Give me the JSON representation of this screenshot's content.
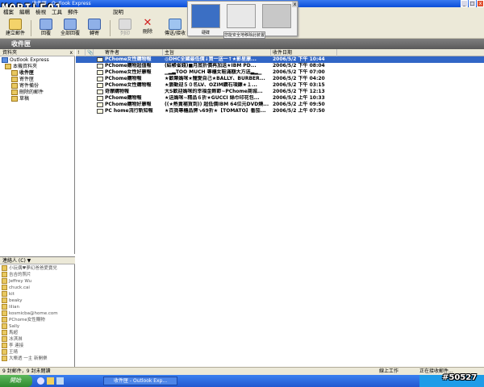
{
  "app": {
    "logo": "MOBILE01",
    "title": "收件匣 - Outlook Express"
  },
  "menubar": {
    "items": [
      "檔案",
      "編輯",
      "檢視",
      "工具",
      "郵件",
      "說明"
    ]
  },
  "toolbar": {
    "buttons": [
      {
        "label": "建立郵件",
        "icon": "new-mail-icon"
      },
      {
        "label": "回覆",
        "icon": "reply-icon"
      },
      {
        "label": "全部回覆",
        "icon": "reply-all-icon"
      },
      {
        "label": "轉寄",
        "icon": "forward-icon"
      },
      {
        "label": "列印",
        "icon": "print-icon"
      },
      {
        "label": "刪除",
        "icon": "delete-icon"
      },
      {
        "label": "傳送/接收",
        "icon": "send-receive-icon"
      }
    ]
  },
  "popup": {
    "device_label": "硬碟",
    "caption": "您能安全地移除此裝置"
  },
  "folder_header": {
    "title": "收件匣"
  },
  "folders": {
    "header": "資料夾",
    "items": [
      {
        "label": "Outlook Express",
        "indent": 0
      },
      {
        "label": "本機資料夾",
        "indent": 1
      },
      {
        "label": "收件匣",
        "indent": 2,
        "bold": true
      },
      {
        "label": "寄件匣",
        "indent": 2
      },
      {
        "label": "寄件備份",
        "indent": 2
      },
      {
        "label": "刪除的郵件",
        "indent": 2
      },
      {
        "label": "草稿",
        "indent": 2
      }
    ]
  },
  "contacts": {
    "header": "連絡人 (C) ▼",
    "items": [
      "小玩偶♥夢幻爸爸愛寶兒",
      "吉吉的照片",
      "Jeffrey Wu",
      "chuck.cai",
      "kit",
      "beaky",
      "lilian",
      "kosmicba@home.com",
      "PChome女性購物",
      "Sally",
      "馬超",
      "冰淇淋",
      "李 連接",
      "王晴",
      "大樂透 一主 新開樂"
    ]
  },
  "message_list": {
    "columns": [
      "!",
      "📎",
      "寄件者",
      "主旨",
      "收件日期"
    ],
    "rows": [
      {
        "from": "PChome女性購物報",
        "subject": "◎DHC全國最低價↓買一送一↑★影星康...",
        "date": "2006/5/2 下午 10:44",
        "selected": true
      },
      {
        "from": "PChome購物超值報",
        "subject": "(結帳省錢)■月底折價再加送★IBM PD...",
        "date": "2006/5/2 下午 08:04"
      },
      {
        "from": "PChome女性好康報",
        "subject": "▁▂▃TOO MUCH 專櫃女鞋滿額大方送▃▂▁",
        "date": "2006/5/2 下午 07:00"
      },
      {
        "from": "PChome購物報",
        "subject": "★歡樂媽咪★寵愛自己★BALLY、BURBER...",
        "date": "2006/5/2 下午 04:20"
      },
      {
        "from": "PChome女性購物報",
        "subject": "★脈動迎５０名LV、OZIM鑽石項鍊★１...",
        "date": "2006/5/2 下午 03:15"
      },
      {
        "from": "奇摩購物報",
        "subject": "大S歡迎媽咪的幸福金飾節~PChome商城...",
        "date": "2006/5/2 下午 12:13"
      },
      {
        "from": "PChome購物報",
        "subject": "★送媽咪~精品６折★GUCCI 絲巾印花包...",
        "date": "2006/5/2 上午 10:33"
      },
      {
        "from": "PChome購物好康報",
        "subject": "((★熱賣補貨到)) 超低價IBM 64位元DVD燒...",
        "date": "2006/5/2 上午 09:50"
      },
      {
        "from": "PC home流行新知報",
        "subject": "★百貨專櫃品牌↘69折★【TOMATO】番茄...",
        "date": "2006/5/2 上午 07:50"
      }
    ]
  },
  "statusbar": {
    "left": "9 封郵件，9 封未閱讀",
    "work": "線上工作",
    "receiving": "正在接收郵件..."
  },
  "taskbar": {
    "start": "開始",
    "task": "收件匣 - Outlook Exp...",
    "watermark": "#50527"
  }
}
